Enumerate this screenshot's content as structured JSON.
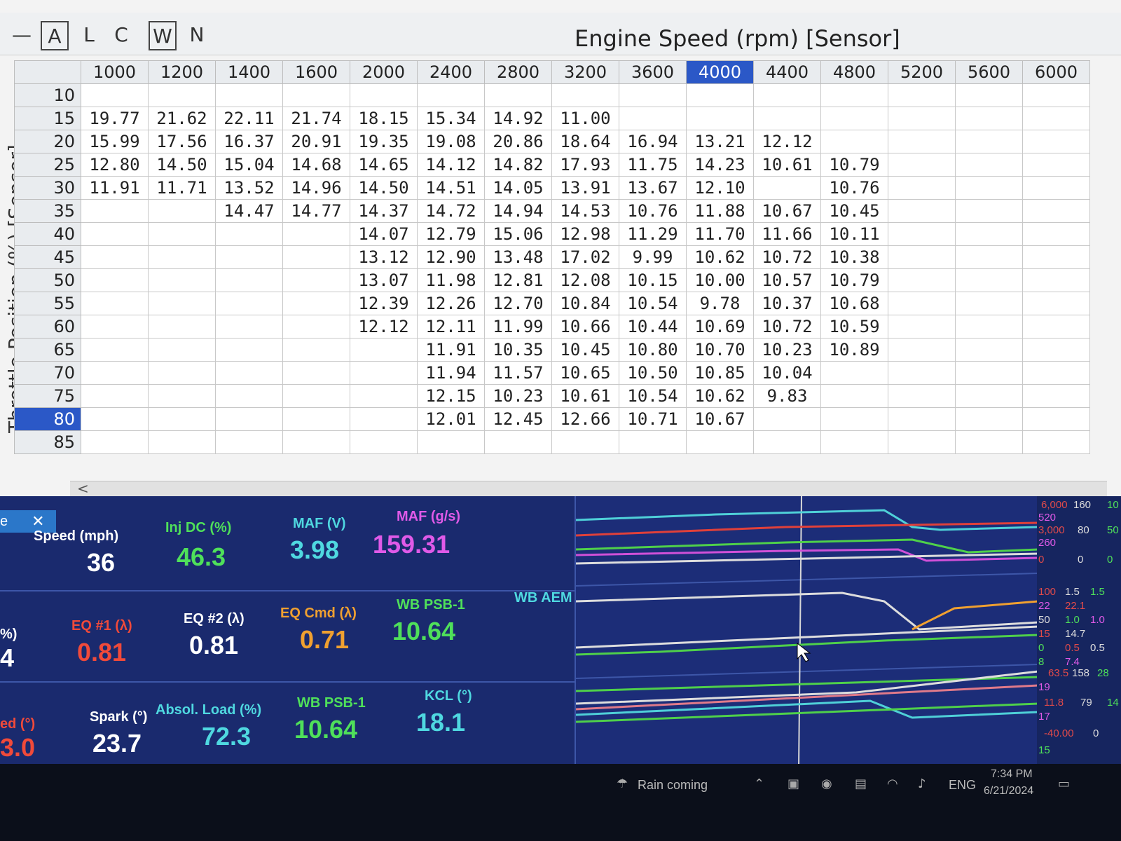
{
  "toolbar": {
    "buttons": [
      "—",
      "A",
      "L",
      "C",
      "W",
      "N"
    ],
    "title": "Engine Speed (rpm) [Sensor]"
  },
  "table": {
    "y_axis_title": "Throttle Position (%) [Sensor]",
    "columns": [
      "1000",
      "1200",
      "1400",
      "1600",
      "2000",
      "2400",
      "2800",
      "3200",
      "3600",
      "4000",
      "4400",
      "4800",
      "5200",
      "5600",
      "6000"
    ],
    "selected_column": "4000",
    "rows": [
      {
        "label": "10",
        "cells": [
          "",
          "",
          "",
          "",
          "",
          "",
          "",
          "",
          "",
          "",
          "",
          "",
          "",
          "",
          ""
        ]
      },
      {
        "label": "15",
        "cells": [
          "19.77",
          "21.62",
          "22.11",
          "21.74",
          "18.15",
          "15.34",
          "14.92",
          "11.00",
          "",
          "",
          "",
          "",
          "",
          "",
          ""
        ]
      },
      {
        "label": "20",
        "cells": [
          "15.99",
          "17.56",
          "16.37",
          "20.91",
          "19.35",
          "19.08",
          "20.86",
          "18.64",
          "16.94",
          "13.21",
          "12.12",
          "",
          "",
          "",
          ""
        ]
      },
      {
        "label": "25",
        "cells": [
          "12.80",
          "14.50",
          "15.04",
          "14.68",
          "14.65",
          "14.12",
          "14.82",
          "17.93",
          "11.75",
          "14.23",
          "10.61",
          "10.79",
          "",
          "",
          ""
        ]
      },
      {
        "label": "30",
        "cells": [
          "11.91",
          "11.71",
          "13.52",
          "14.96",
          "14.50",
          "14.51",
          "14.05",
          "13.91",
          "13.67",
          "12.10",
          "",
          "10.76",
          "",
          "",
          ""
        ]
      },
      {
        "label": "35",
        "cells": [
          "",
          "",
          "14.47",
          "14.77",
          "14.37",
          "14.72",
          "14.94",
          "14.53",
          "10.76",
          "11.88",
          "10.67",
          "10.45",
          "",
          "",
          ""
        ]
      },
      {
        "label": "40",
        "cells": [
          "",
          "",
          "",
          "",
          "14.07",
          "12.79",
          "15.06",
          "12.98",
          "11.29",
          "11.70",
          "11.66",
          "10.11",
          "",
          "",
          ""
        ]
      },
      {
        "label": "45",
        "cells": [
          "",
          "",
          "",
          "",
          "13.12",
          "12.90",
          "13.48",
          "17.02",
          "9.99",
          "10.62",
          "10.72",
          "10.38",
          "",
          "",
          ""
        ]
      },
      {
        "label": "50",
        "cells": [
          "",
          "",
          "",
          "",
          "13.07",
          "11.98",
          "12.81",
          "12.08",
          "10.15",
          "10.00",
          "10.57",
          "10.79",
          "",
          "",
          ""
        ]
      },
      {
        "label": "55",
        "cells": [
          "",
          "",
          "",
          "",
          "12.39",
          "12.26",
          "12.70",
          "10.84",
          "10.54",
          "9.78",
          "10.37",
          "10.68",
          "",
          "",
          ""
        ]
      },
      {
        "label": "60",
        "cells": [
          "",
          "",
          "",
          "",
          "12.12",
          "12.11",
          "11.99",
          "10.66",
          "10.44",
          "10.69",
          "10.72",
          "10.59",
          "",
          "",
          ""
        ]
      },
      {
        "label": "65",
        "cells": [
          "",
          "",
          "",
          "",
          "",
          "11.91",
          "10.35",
          "10.45",
          "10.80",
          "10.70",
          "10.23",
          "10.89",
          "",
          "",
          ""
        ]
      },
      {
        "label": "70",
        "cells": [
          "",
          "",
          "",
          "",
          "",
          "11.94",
          "11.57",
          "10.65",
          "10.50",
          "10.85",
          "10.04",
          "",
          "",
          "",
          ""
        ]
      },
      {
        "label": "75",
        "cells": [
          "",
          "",
          "",
          "",
          "",
          "12.15",
          "10.23",
          "10.61",
          "10.54",
          "10.62",
          "9.83",
          "",
          "",
          "",
          ""
        ]
      },
      {
        "label": "80",
        "cells": [
          "",
          "",
          "",
          "",
          "",
          "12.01",
          "12.45",
          "12.66",
          "10.71",
          "10.67",
          "",
          "",
          "",
          "",
          ""
        ]
      },
      {
        "label": "85",
        "cells": [
          "",
          "",
          "",
          "",
          "",
          "",
          "",
          "",
          "",
          "",
          "",
          "",
          "",
          "",
          ""
        ]
      }
    ],
    "selected_row": "80",
    "colors": {
      "red": "#d9342b",
      "pink": "#f2b6cb",
      "green": "#5cbf45",
      "light_green": "#9adb8a",
      "selected": "#4aa7e0",
      "header_selected": "#2b58c7"
    }
  },
  "dashboard": {
    "tab_label": "e",
    "gauges": [
      {
        "label": "Speed (mph)",
        "value": "36",
        "color": "#ffffff"
      },
      {
        "label": "Inj DC (%)",
        "value": "46.3",
        "color": "#4fe05a"
      },
      {
        "label": "MAF (V)",
        "value": "3.98",
        "color": "#4fd8e0"
      },
      {
        "label": "MAF (g/s)",
        "value": "159.31",
        "color": "#e05ae8"
      },
      {
        "label": "%)",
        "value": "4",
        "color": "#ffffff"
      },
      {
        "label": "EQ #1 (λ)",
        "value": "0.81",
        "color": "#f04a3a"
      },
      {
        "label": "EQ #2 (λ)",
        "value": "0.81",
        "color": "#ffffff"
      },
      {
        "label": "EQ Cmd (λ)",
        "value": "0.71",
        "color": "#f0a030"
      },
      {
        "label": "WB PSB-1",
        "value": "10.64",
        "color": "#4fe05a"
      },
      {
        "label": "WB AEM",
        "value": "",
        "color": "#4fd8e0"
      },
      {
        "label": "ed (°)",
        "value": "3.0",
        "color": "#f04a3a"
      },
      {
        "label": "Spark (°)",
        "value": "23.7",
        "color": "#ffffff"
      },
      {
        "label": "Absol. Load (%)",
        "value": "72.3",
        "color": "#4fd8e0"
      },
      {
        "label": "WB PSB-1",
        "value": "10.64",
        "color": "#4fe05a"
      },
      {
        "label": "KCL (°)",
        "value": "18.1",
        "color": "#4fd8e0"
      }
    ],
    "scales": {
      "panel1": [
        "6,000",
        "160",
        "10",
        "520",
        "3,000",
        "80",
        "50",
        "260",
        "0",
        "0",
        "0"
      ],
      "panel2": [
        "100",
        "1.5",
        "1.5",
        "22",
        "22.1",
        "50",
        "1.0",
        "1.0",
        "15",
        "14.7",
        "0",
        "0.5",
        "0.5",
        "8",
        "7.4"
      ],
      "panel3": [
        "63.5",
        "158",
        "28",
        "19",
        "11.8",
        "79",
        "14",
        "17",
        "-40.00",
        "0",
        "15"
      ]
    }
  },
  "taskbar": {
    "weather": "Rain coming",
    "language": "ENG",
    "time": "7:34 PM",
    "date": "6/21/2024"
  }
}
